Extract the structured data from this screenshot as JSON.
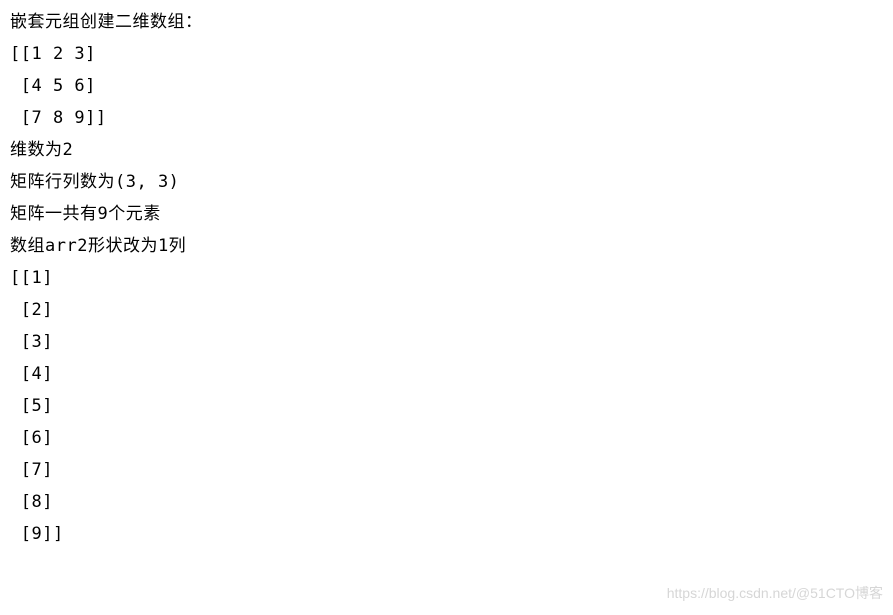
{
  "lines": {
    "l0": "嵌套元组创建二维数组：",
    "l1": "[[1 2 3]",
    "l2": " [4 5 6]",
    "l3": " [7 8 9]]",
    "l4": "维数为2",
    "l5": "矩阵行列数为(3, 3)",
    "l6": "矩阵一共有9个元素",
    "l7": "数组arr2形状改为1列",
    "l8": "[[1]",
    "l9": " [2]",
    "l10": " [3]",
    "l11": " [4]",
    "l12": " [5]",
    "l13": " [6]",
    "l14": " [7]",
    "l15": " [8]",
    "l16": " [9]]"
  },
  "watermark": "https://blog.csdn.net/@51CTO博客"
}
